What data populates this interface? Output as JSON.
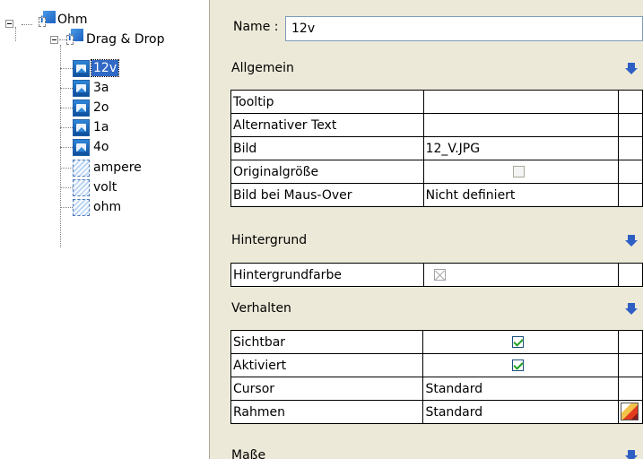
{
  "tree": {
    "root": {
      "label": "Ohm"
    },
    "group": {
      "label": "Drag & Drop"
    },
    "items": [
      {
        "label": "12v",
        "kind": "image",
        "selected": true
      },
      {
        "label": "3a",
        "kind": "image"
      },
      {
        "label": "2o",
        "kind": "image"
      },
      {
        "label": "1a",
        "kind": "image"
      },
      {
        "label": "4o",
        "kind": "image"
      },
      {
        "label": "ampere",
        "kind": "area"
      },
      {
        "label": "volt",
        "kind": "area"
      },
      {
        "label": "ohm",
        "kind": "area"
      }
    ]
  },
  "props": {
    "name_label": "Name :",
    "name_value": "12v",
    "sections": {
      "allgemein": {
        "title": "Allgemein",
        "rows": [
          {
            "label": "Tooltip",
            "value": ""
          },
          {
            "label": "Alternativer Text",
            "value": ""
          },
          {
            "label": "Bild",
            "value": "12_V.JPG"
          },
          {
            "label": "Originalgröße",
            "value": "",
            "checkbox": "unchecked"
          },
          {
            "label": "Bild bei Maus-Over",
            "value": "Nicht definiert"
          }
        ]
      },
      "hintergrund": {
        "title": "Hintergrund",
        "rows": [
          {
            "label": "Hintergrundfarbe",
            "value": "",
            "color": "none"
          }
        ]
      },
      "verhalten": {
        "title": "Verhalten",
        "rows": [
          {
            "label": "Sichtbar",
            "value": "",
            "checkbox": "checked"
          },
          {
            "label": "Aktiviert",
            "value": "",
            "checkbox": "checked"
          },
          {
            "label": "Cursor",
            "value": "Standard"
          },
          {
            "label": "Rahmen",
            "value": "Standard"
          }
        ]
      },
      "masse": {
        "title": "Maße"
      }
    }
  },
  "colors": {
    "selection": "#3169c6",
    "panel": "#ece9d8",
    "section_arrow": "#2f5fc4",
    "checkmark": "#21a121"
  }
}
